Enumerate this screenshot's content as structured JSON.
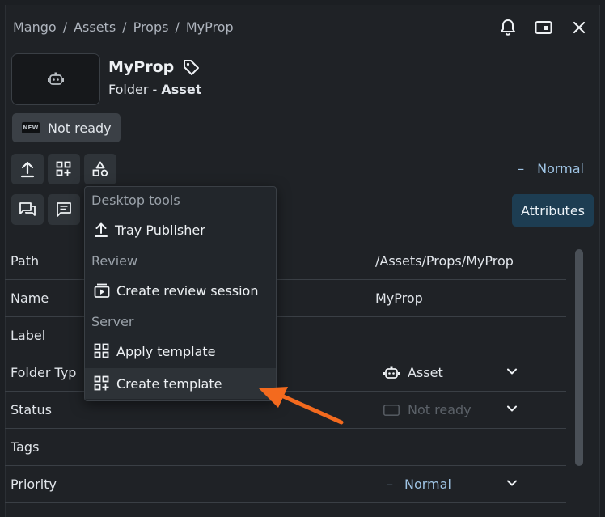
{
  "breadcrumb": [
    "Mango",
    "/",
    "Assets",
    "/",
    "Props",
    "/",
    "MyProp"
  ],
  "entity": {
    "name": "MyProp",
    "type_label": "Folder -",
    "type_value": "Asset",
    "status": "Not ready",
    "status_icon_text": "NEW"
  },
  "priority": {
    "dash": "–",
    "value": "Normal"
  },
  "attributes_button": "Attributes",
  "menu": {
    "sections": [
      {
        "title": "Desktop tools",
        "items": [
          {
            "label": "Tray Publisher",
            "icon": "upload-icon"
          }
        ]
      },
      {
        "title": "Review",
        "items": [
          {
            "label": "Create review session",
            "icon": "review-session-icon"
          }
        ]
      },
      {
        "title": "Server",
        "items": [
          {
            "label": "Apply template",
            "icon": "template-icon"
          },
          {
            "label": "Create template",
            "icon": "create-template-icon"
          }
        ]
      }
    ]
  },
  "attributes": [
    {
      "label": "Path",
      "value": "/Assets/Props/MyProp"
    },
    {
      "label": "Name",
      "value": "MyProp"
    },
    {
      "label": "Label",
      "value": ""
    },
    {
      "label": "Folder Typ",
      "value": "Asset"
    },
    {
      "label": "Status",
      "value": "Not ready"
    },
    {
      "label": "Tags",
      "value": ""
    },
    {
      "label": "Priority",
      "value": "Normal",
      "dash": "–"
    }
  ],
  "colors": {
    "accent_arrow": "#f36a1e",
    "priority_blue": "#9fc4e4",
    "attributes_button_bg": "#1d3d52"
  }
}
